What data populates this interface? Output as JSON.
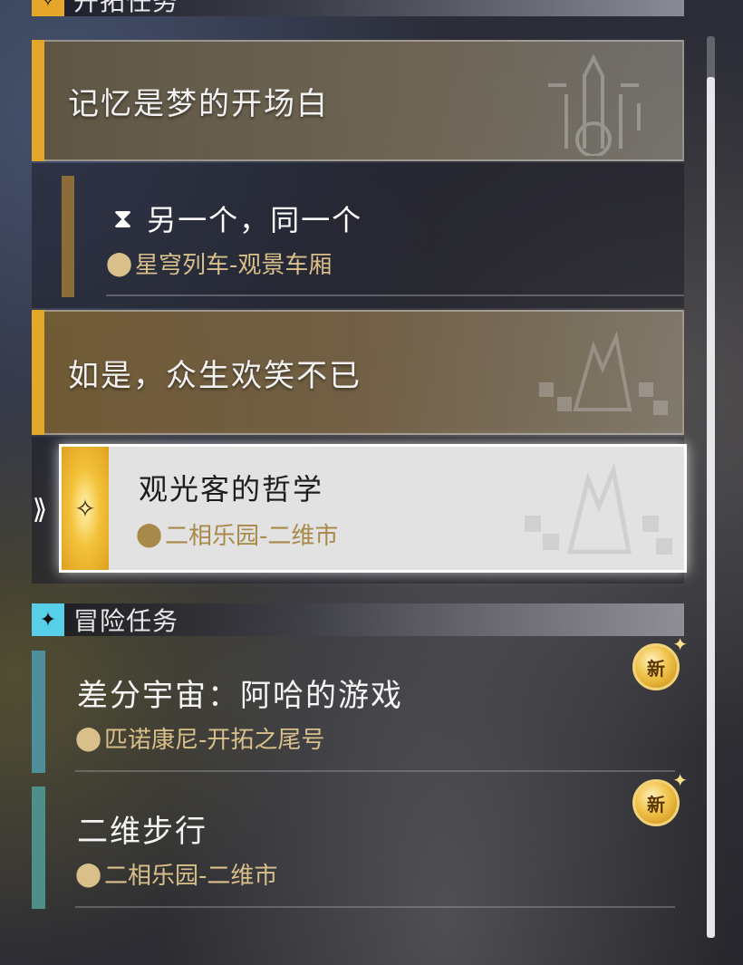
{
  "sections": {
    "trailblaze": {
      "title": "开拓任务",
      "icon": "trailblaze-icon"
    },
    "adventure": {
      "title": "冒险任务",
      "icon": "four-point-star-icon"
    }
  },
  "trailblaze_quests": [
    {
      "chapter": "记忆是梦的开场白",
      "subquest": {
        "title": "另一个，同一个",
        "location": "星穹列车-观景车厢",
        "icon": "hourglass-icon"
      }
    },
    {
      "chapter": "如是，众生欢笑不已",
      "subquest": {
        "title": "观光客的哲学",
        "location": "二相乐园-二维市",
        "selected": true
      }
    }
  ],
  "adventure_missions": [
    {
      "title": "差分宇宙：阿哈的游戏",
      "location": "匹诺康尼-开拓之尾号",
      "badge": "新"
    },
    {
      "title": "二维步行",
      "location": "二相乐园-二维市",
      "badge": "新"
    }
  ],
  "colors": {
    "trailblaze_accent": "#e4a72a",
    "adventure_accent": "#57cfe9",
    "location_text": "#d9c08a"
  }
}
